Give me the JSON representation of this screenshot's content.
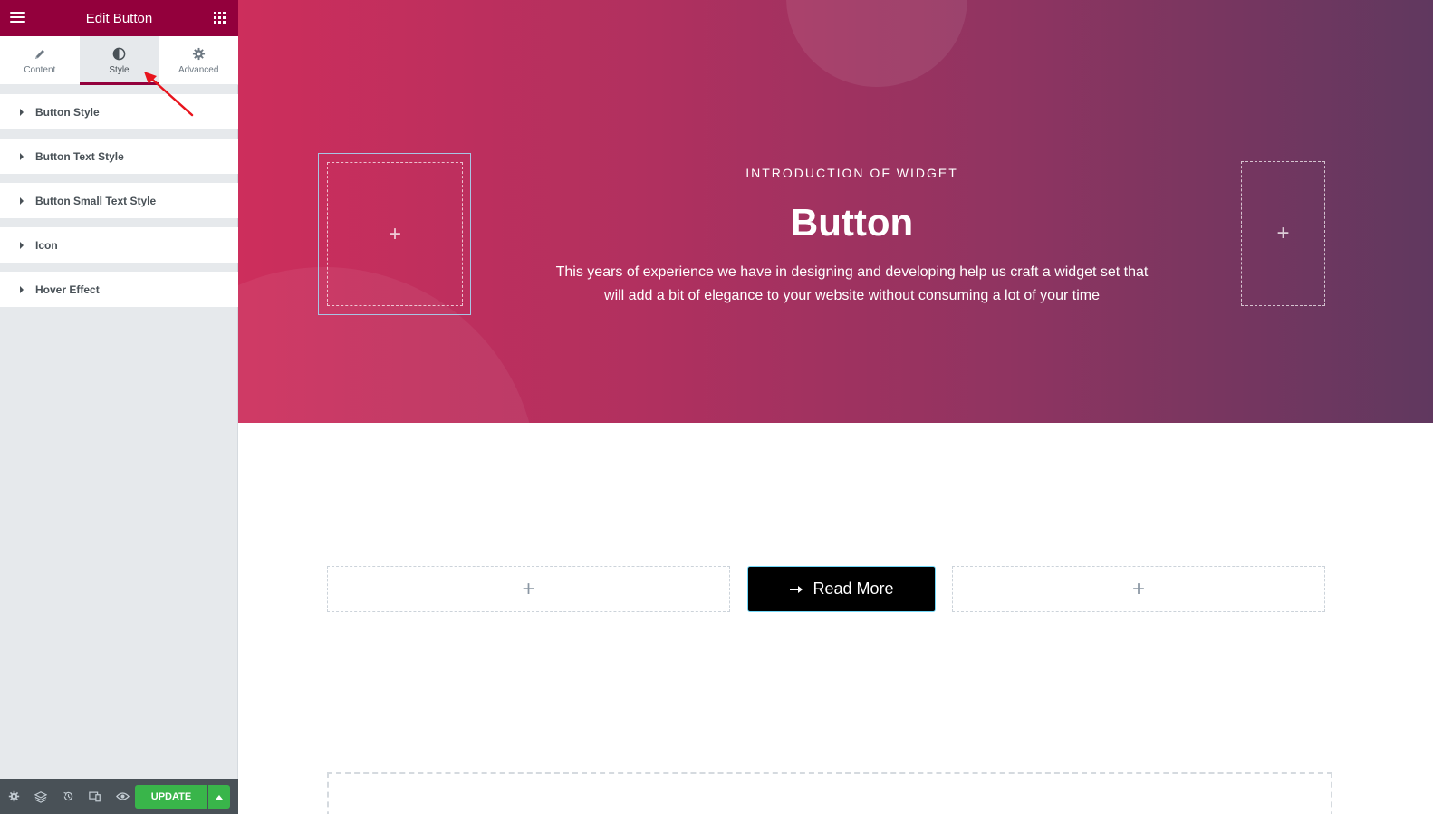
{
  "panel": {
    "title": "Edit Button",
    "tabs": [
      {
        "label": "Content",
        "icon": "pencil-icon"
      },
      {
        "label": "Style",
        "icon": "half-circle-icon",
        "active": true
      },
      {
        "label": "Advanced",
        "icon": "gear-icon"
      }
    ],
    "sections": [
      {
        "label": "Button Style"
      },
      {
        "label": "Button Text Style"
      },
      {
        "label": "Button Small Text Style"
      },
      {
        "label": "Icon"
      },
      {
        "label": "Hover Effect"
      }
    ],
    "footer": {
      "update_label": "UPDATE"
    }
  },
  "hero": {
    "eyebrow": "INTRODUCTION OF WIDGET",
    "title": "Button",
    "description": "This years of experience we have in designing and developing help us craft a widget set that will add a bit of elegance to your website without consuming a lot of your time"
  },
  "cta": {
    "label": "Read More",
    "icon": "arrow-right-icon"
  },
  "colors": {
    "panel_header": "#93003c",
    "update_button": "#39b54a",
    "hero_gradient_start": "#cd2e5c",
    "hero_gradient_end": "#60385f",
    "button_bg": "#000000"
  }
}
